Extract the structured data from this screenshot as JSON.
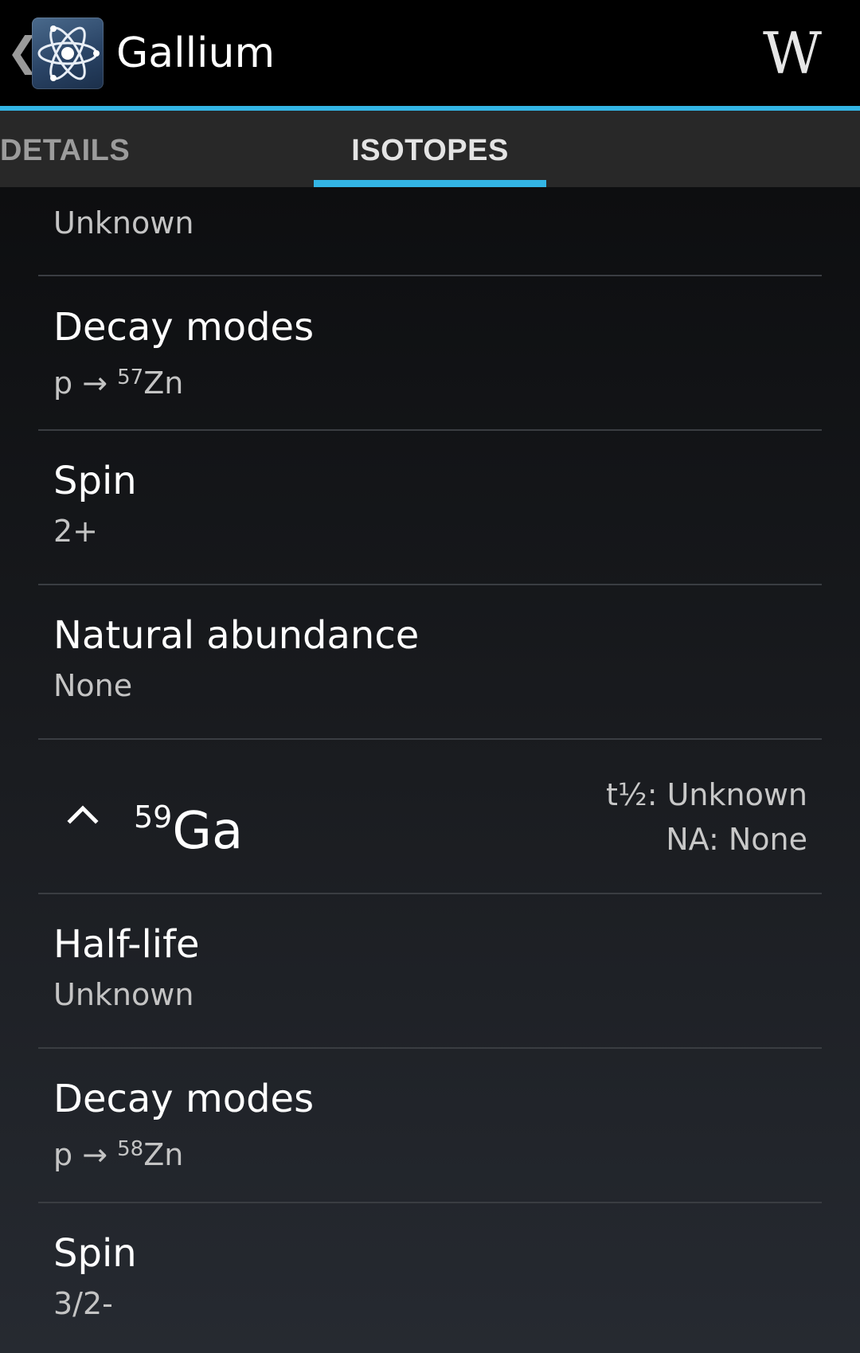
{
  "action_bar": {
    "title": "Gallium",
    "up_caret": "❮",
    "app_icon": "atom-icon",
    "wiki_button_label": "W",
    "accent_color": "#33b5e5"
  },
  "tabs": [
    {
      "label": "DETAILS",
      "selected": false
    },
    {
      "label": "ISOTOPES",
      "selected": true
    }
  ],
  "partial_top_value": "Unknown",
  "isotope_58": {
    "properties": [
      {
        "label": "Decay modes",
        "value_prefix": "p → ",
        "value_sup": "57",
        "value_suffix": "Zn"
      },
      {
        "label": "Spin",
        "value": "2+"
      },
      {
        "label": "Natural abundance",
        "value": "None"
      }
    ]
  },
  "isotope_59": {
    "mass_number": "59",
    "symbol": "Ga",
    "expanded": true,
    "summary_half_life": "t½: Unknown",
    "summary_abundance": "NA: None",
    "properties": [
      {
        "label": "Half-life",
        "value": "Unknown"
      },
      {
        "label": "Decay modes",
        "value_prefix": "p → ",
        "value_sup": "58",
        "value_suffix": "Zn"
      },
      {
        "label": "Spin",
        "value": "3/2-"
      }
    ]
  }
}
